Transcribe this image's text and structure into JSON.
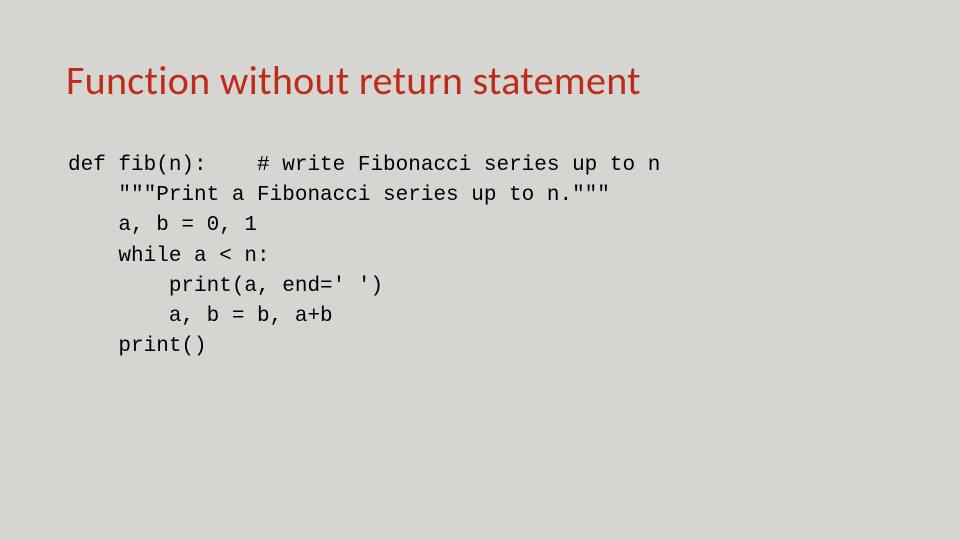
{
  "title": "Function without return statement",
  "code": {
    "line1": "def fib(n):    # write Fibonacci series up to n",
    "line2": "    \"\"\"Print a Fibonacci series up to n.\"\"\"",
    "line3": "    a, b = 0, 1",
    "line4": "    while a < n:",
    "line5": "        print(a, end=' ')",
    "line6": "        a, b = b, a+b",
    "line7": "    print()"
  }
}
